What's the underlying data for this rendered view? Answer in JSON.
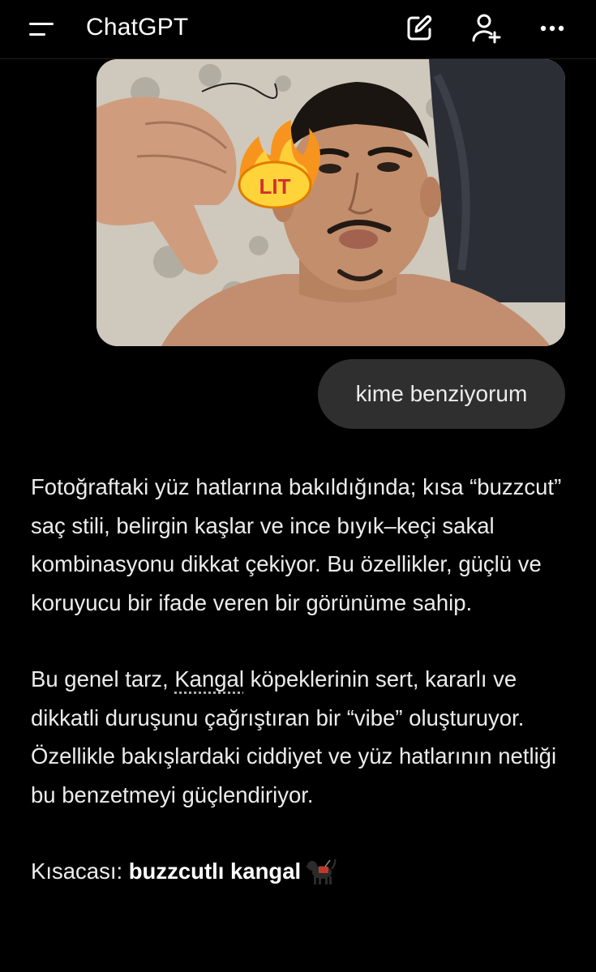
{
  "header": {
    "title": "ChatGPT",
    "icons": [
      "menu-icon",
      "edit-icon",
      "add-user-icon",
      "more-icon"
    ]
  },
  "attachment": {
    "sticker_text": "LIT",
    "sticker_icon": "fire-icon"
  },
  "user_message": {
    "text": "kime benziyorum"
  },
  "assistant_message": {
    "para1": "Fotoğraftaki yüz hatlarına bakıldığında; kısa “buzzcut” saç stili, belirgin kaşlar ve ince bıyık–keçi sakal kombinasyonu dikkat çekiyor. Bu özellikler, güçlü ve koruyucu bir ifade veren bir görünüme sahip.",
    "para2_before": "Bu genel tarz, ",
    "para2_link": "Kangal",
    "para2_after": " köpeklerinin sert, kararlı ve dikkatli duruşunu çağrıştıran bir “vibe” oluşturuyor. Özellikle bakışlardaki ciddiyet ve yüz hatlarının netliği bu benzetmeyi güçlendiriyor.",
    "para3_prefix": "Kısacası: ",
    "para3_bold": "buzzcutlı kangal",
    "para3_emoji": "service-dog-emoji"
  },
  "colors": {
    "background": "#000000",
    "bubble": "#2f2f2f",
    "text": "#ececec"
  }
}
